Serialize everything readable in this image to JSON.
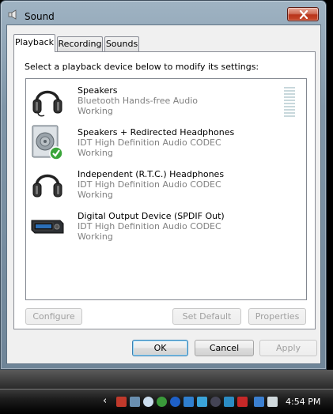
{
  "window": {
    "title": "Sound",
    "close_icon": "close-x-icon"
  },
  "tabs": [
    {
      "label": "Playback",
      "active": true
    },
    {
      "label": "Recording",
      "active": false
    },
    {
      "label": "Sounds",
      "active": false
    }
  ],
  "instruction": "Select a playback device below to modify its settings:",
  "devices": [
    {
      "name": "Speakers",
      "description": "Bluetooth Hands-free Audio",
      "status": "Working",
      "icon": "headphones-icon",
      "is_default": false
    },
    {
      "name": "Speakers + Redirected Headphones",
      "description": "IDT High Definition Audio CODEC",
      "status": "Working",
      "icon": "speaker-icon",
      "is_default": true
    },
    {
      "name": "Independent (R.T.C.) Headphones",
      "description": "IDT High Definition Audio CODEC",
      "status": "Working",
      "icon": "headphones-icon",
      "is_default": false
    },
    {
      "name": "Digital Output Device (SPDIF Out)",
      "description": "IDT High Definition Audio CODEC",
      "status": "Working",
      "icon": "digital-output-icon",
      "is_default": false
    }
  ],
  "buttons": {
    "configure": "Configure",
    "set_default": "Set Default",
    "properties": "Properties",
    "ok": "OK",
    "cancel": "Cancel",
    "apply": "Apply"
  },
  "taskbar": {
    "clock": "4:54 PM",
    "chevron": "‹"
  },
  "colors": {
    "accent_default_button": "#3c7fb1",
    "default_check": "#3aa53a"
  }
}
